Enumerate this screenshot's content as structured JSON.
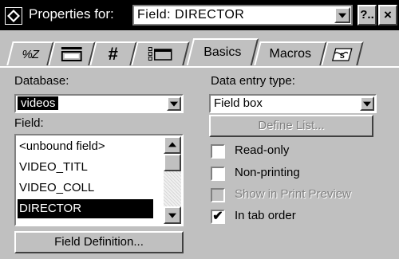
{
  "window": {
    "title_label": "Properties for:",
    "field_selector_value": "Field: DIRECTOR",
    "help_label": "?..",
    "close_label": "×"
  },
  "tabs": [
    {
      "label": "%Z",
      "icon": "format-icon"
    },
    {
      "label": "",
      "icon": "display-icon"
    },
    {
      "label": "#",
      "icon": "number-format-icon"
    },
    {
      "label": "",
      "icon": "object-icon"
    },
    {
      "label": "Basics",
      "active": true
    },
    {
      "label": "Macros"
    },
    {
      "label": "",
      "icon": "script-icon"
    }
  ],
  "basics": {
    "database_label": "Database:",
    "database_value": "videos",
    "field_label": "Field:",
    "field_options": [
      "<unbound field>",
      "VIDEO_TITL",
      "VIDEO_COLL",
      "DIRECTOR"
    ],
    "field_selected": "DIRECTOR",
    "field_definition_label": "Field Definition...",
    "data_entry_type_label": "Data entry type:",
    "data_entry_type_value": "Field box",
    "define_list_label": "Define List...",
    "checkboxes": [
      {
        "label": "Read-only",
        "checked": false,
        "enabled": true
      },
      {
        "label": "Non-printing",
        "checked": false,
        "enabled": true
      },
      {
        "label": "Show in Print Preview",
        "checked": false,
        "enabled": false
      },
      {
        "label": "In tab order",
        "checked": true,
        "enabled": true
      }
    ]
  }
}
